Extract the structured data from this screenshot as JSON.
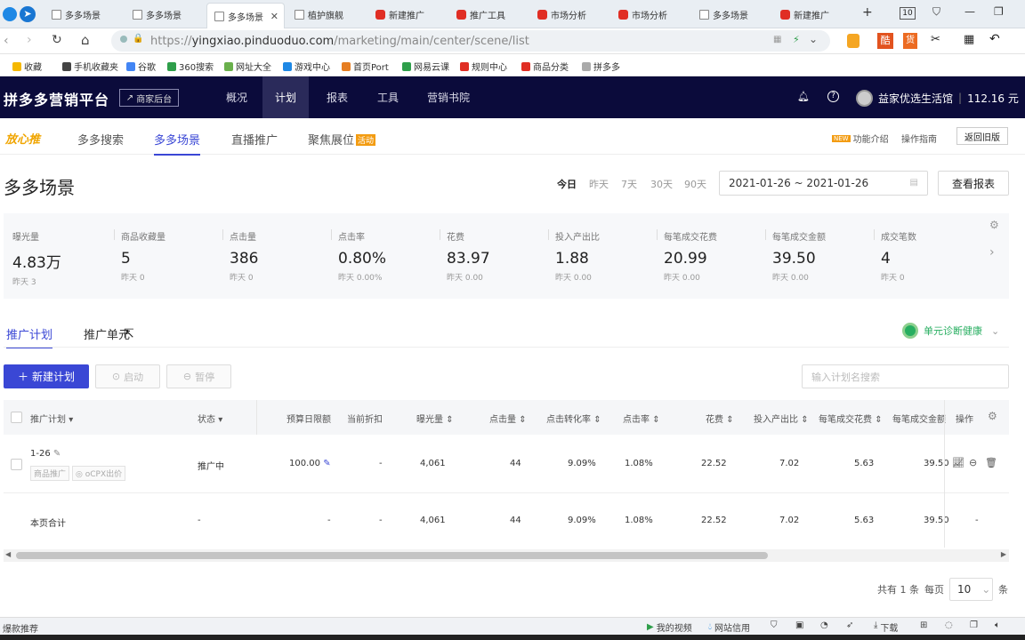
{
  "browser": {
    "tabs": [
      {
        "label": "多多场景",
        "icon": "page-icon",
        "active": false
      },
      {
        "label": "多多场景",
        "icon": "page-icon",
        "active": false
      },
      {
        "label": "多多场景",
        "icon": "page-icon",
        "active": true
      },
      {
        "label": "植护旗舰",
        "icon": "page-icon",
        "active": false
      },
      {
        "label": "新建推广",
        "icon": "pdd-icon",
        "active": false
      },
      {
        "label": "推广工具",
        "icon": "pdd-icon",
        "active": false
      },
      {
        "label": "市场分析",
        "icon": "pdd-icon",
        "active": false
      },
      {
        "label": "市场分析",
        "icon": "pdd-icon",
        "active": false
      },
      {
        "label": "多多场景",
        "icon": "page-icon",
        "active": false
      },
      {
        "label": "新建推广",
        "icon": "pdd-icon",
        "active": false
      }
    ],
    "tab_count": "10",
    "url_scheme": "https://",
    "url_host": "yingxiao.pinduoduo.com",
    "url_path": "/marketing/main/center/scene/list",
    "bookmarks": [
      "收藏",
      "手机收藏夹",
      "谷歌",
      "360搜索",
      "网址大全",
      "游戏中心",
      "首页Port",
      "网易云课",
      "规则中心",
      "商品分类",
      "拼多多"
    ]
  },
  "topnav": {
    "logo": "拼多多营销平台",
    "merchant_btn": "商家后台",
    "items": [
      "概况",
      "计划",
      "报表",
      "工具",
      "营销书院"
    ],
    "active": "计划",
    "account_name": "益家优选生活馆",
    "balance": "112.16 元"
  },
  "subnav": {
    "brand": "放心推",
    "items": [
      "多多搜索",
      "多多场景",
      "直播推广",
      "聚焦展位"
    ],
    "hot_badge": "活动",
    "new_badge": "NEW",
    "feature_intro": "功能介绍",
    "guide": "操作指南",
    "back_old": "返回旧版"
  },
  "page": {
    "title": "多多场景",
    "ranges": [
      "今日",
      "昨天",
      "7天",
      "30天",
      "90天"
    ],
    "date_range": "2021-01-26 ~ 2021-01-26",
    "report_btn": "查看报表"
  },
  "metrics": [
    {
      "label": "曝光量",
      "value": "4.83万",
      "prev": "昨天 3"
    },
    {
      "label": "商品收藏量",
      "value": "5",
      "prev": "昨天 0"
    },
    {
      "label": "点击量",
      "value": "386",
      "prev": "昨天 0"
    },
    {
      "label": "点击率",
      "value": "0.80%",
      "prev": "昨天 0.00%"
    },
    {
      "label": "花费",
      "value": "83.97",
      "prev": "昨天 0.00"
    },
    {
      "label": "投入产出比",
      "value": "1.88",
      "prev": "昨天 0.00"
    },
    {
      "label": "每笔成交花费",
      "value": "20.99",
      "prev": "昨天 0.00"
    },
    {
      "label": "每笔成交金额",
      "value": "39.50",
      "prev": "昨天 0.00"
    },
    {
      "label": "成交笔数",
      "value": "4",
      "prev": "昨天 0"
    }
  ],
  "inner_tabs": [
    "推广计划",
    "推广单元"
  ],
  "health": "单元诊断健康",
  "toolbar": {
    "new_plan": "新建计划",
    "start": "启动",
    "pause": "暂停",
    "search_placeholder": "输入计划名搜索"
  },
  "table": {
    "headers": [
      "推广计划",
      "状态",
      "预算日限额",
      "当前折扣",
      "曝光量",
      "点击量",
      "点击转化率",
      "点击率",
      "花费",
      "投入产出比",
      "每笔成交花费",
      "每笔成交金额",
      "操作"
    ],
    "rows": [
      {
        "name": "1-26",
        "tags": [
          "商品推广",
          "oCPX出价"
        ],
        "status": "推广中",
        "budget": "100.00",
        "discount": "-",
        "impressions": "4,061",
        "clicks": "44",
        "cvr": "9.09%",
        "ctr": "1.08%",
        "spend": "22.52",
        "roi": "7.02",
        "cost_per_order": "5.63",
        "order_amount": "39.50"
      }
    ],
    "total": {
      "name": "本页合计",
      "status": "-",
      "budget": "-",
      "discount": "-",
      "impressions": "4,061",
      "clicks": "44",
      "cvr": "9.09%",
      "ctr": "1.08%",
      "spend": "22.52",
      "roi": "7.02",
      "cost_per_order": "5.63",
      "order_amount": "39.50",
      "ops": "-"
    }
  },
  "pager": {
    "total": "共有 1 条",
    "per_page": "每页",
    "size": "10",
    "unit": "条"
  },
  "statusbar": {
    "left": "爆款推荐",
    "items": [
      "我的视频",
      "网站信用",
      "下载"
    ]
  },
  "colors": {
    "primary": "#3a47d5",
    "nav_bg": "#0b0b3b",
    "health": "#27ae60",
    "pdd_red": "#e02e24"
  }
}
